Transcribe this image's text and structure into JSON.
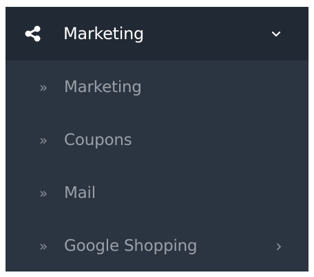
{
  "menu": {
    "header": {
      "label": "Marketing",
      "icon": "share-icon",
      "expanded": true
    },
    "items": [
      {
        "bullet": "»",
        "label": "Marketing"
      },
      {
        "bullet": "»",
        "label": "Coupons"
      },
      {
        "bullet": "»",
        "label": "Mail"
      },
      {
        "bullet": "»",
        "label": "Google Shopping",
        "has_submenu": true
      }
    ]
  },
  "colors": {
    "panel_background": "#2b3441",
    "header_background": "#212934",
    "header_text": "#ffffff",
    "item_text": "#9aa0a8"
  }
}
